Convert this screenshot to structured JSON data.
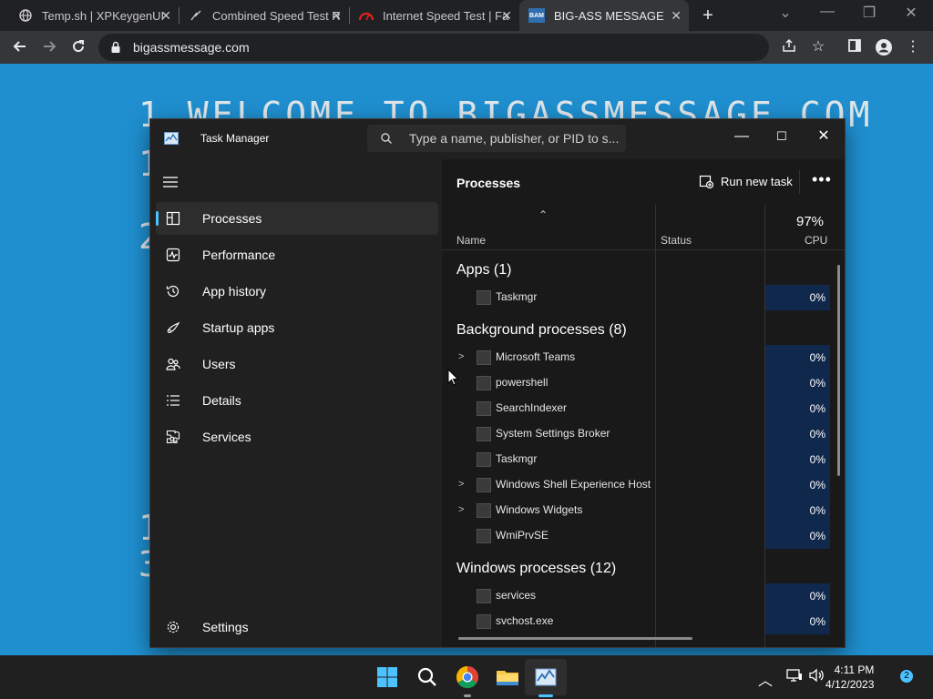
{
  "browser": {
    "tabs": [
      {
        "title": "Temp.sh | XPKeygenUI",
        "icon": "globe-icon"
      },
      {
        "title": "Combined Speed Test R",
        "icon": "speed-icon"
      },
      {
        "title": "Internet Speed Test | Fa",
        "icon": "fast-icon"
      },
      {
        "title": "BIG-ASS MESSAGE",
        "icon": "bam-icon",
        "icon_text": "BAM",
        "active": true
      }
    ],
    "new_tab": "+",
    "url": "bigassmessage.com",
    "window_controls": {
      "minimize": "—",
      "restore": "❐",
      "close": "✕"
    }
  },
  "webpage": {
    "line1": "1 WELCOME TO BIGASSMESSAGE.COM",
    "fragments": [
      "1",
      "2",
      "2",
      "1",
      "3"
    ]
  },
  "task_manager": {
    "title": "Task Manager",
    "search_placeholder": "Type a name, publisher, or PID to s...",
    "nav": [
      {
        "label": "Processes",
        "icon": "processes-icon",
        "selected": true
      },
      {
        "label": "Performance",
        "icon": "performance-icon"
      },
      {
        "label": "App history",
        "icon": "history-icon"
      },
      {
        "label": "Startup apps",
        "icon": "startup-icon"
      },
      {
        "label": "Users",
        "icon": "users-icon"
      },
      {
        "label": "Details",
        "icon": "details-icon"
      },
      {
        "label": "Services",
        "icon": "services-icon"
      }
    ],
    "settings_label": "Settings",
    "main_title": "Processes",
    "run_new_task": "Run new task",
    "more": "•••",
    "columns": {
      "name": "Name",
      "status": "Status",
      "cpu_total": "97%",
      "cpu": "CPU"
    },
    "groups": [
      {
        "label": "Apps (1)",
        "rows": [
          {
            "name": "Taskmgr",
            "cpu": "0%",
            "expandable": false
          }
        ]
      },
      {
        "label": "Background processes (8)",
        "rows": [
          {
            "name": "Microsoft Teams",
            "cpu": "0%",
            "expandable": true
          },
          {
            "name": "powershell",
            "cpu": "0%",
            "expandable": false
          },
          {
            "name": "SearchIndexer",
            "cpu": "0%",
            "expandable": false
          },
          {
            "name": "System Settings Broker",
            "cpu": "0%",
            "expandable": false
          },
          {
            "name": "Taskmgr",
            "cpu": "0%",
            "expandable": false
          },
          {
            "name": "Windows Shell Experience Host",
            "cpu": "0%",
            "expandable": true
          },
          {
            "name": "Windows Widgets",
            "cpu": "0%",
            "expandable": true
          },
          {
            "name": "WmiPrvSE",
            "cpu": "0%",
            "expandable": false
          }
        ]
      },
      {
        "label": "Windows processes (12)",
        "rows": [
          {
            "name": "services",
            "cpu": "0%",
            "expandable": false
          },
          {
            "name": "svchost.exe",
            "cpu": "0%",
            "expandable": false
          }
        ]
      }
    ]
  },
  "taskbar": {
    "time": "4:11 PM",
    "date": "4/12/2023",
    "notification_count": "2",
    "accent": "#4cc2ff"
  }
}
